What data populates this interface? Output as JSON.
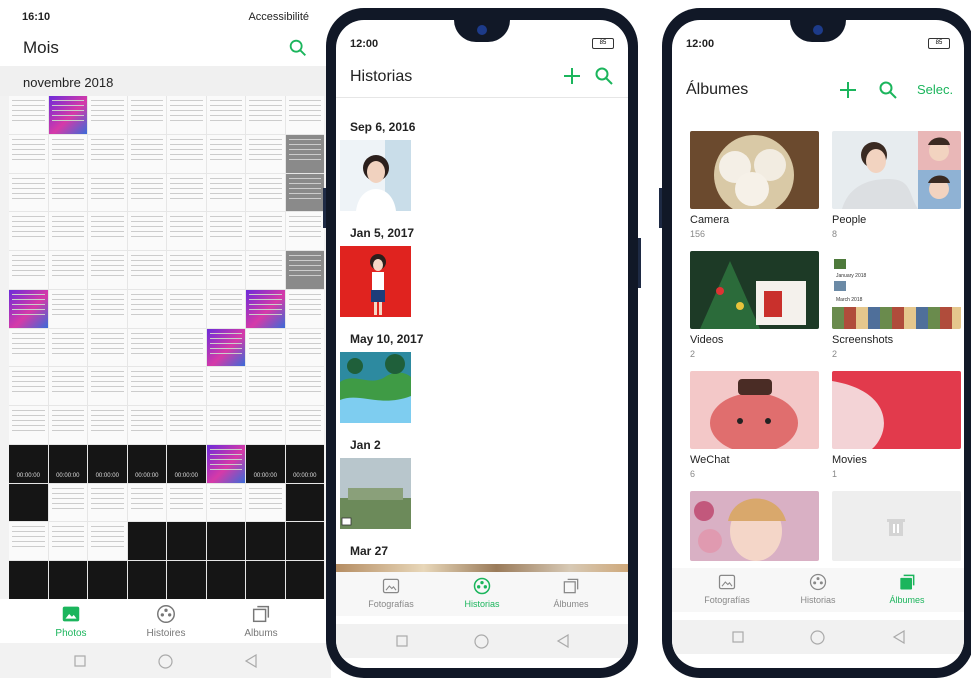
{
  "screen1": {
    "status": {
      "time": "16:10",
      "right_text": "Accessibilité"
    },
    "title": "Mois",
    "month": "novembre 2018",
    "clock_text": "00:00:00",
    "tabs": [
      {
        "label": "Photos",
        "icon": "photos-icon",
        "active": true
      },
      {
        "label": "Histoires",
        "icon": "stories-icon",
        "active": false
      },
      {
        "label": "Albums",
        "icon": "albums-icon",
        "active": false
      }
    ]
  },
  "screen2": {
    "status": {
      "time": "12:00",
      "battery": "85"
    },
    "title": "Historias",
    "dates": [
      "Sep 6, 2016",
      "Jan 5, 2017",
      "May 10, 2017",
      "Jan 2",
      "Mar 27"
    ],
    "tabs": [
      {
        "label": "Fotografías",
        "icon": "photos-icon",
        "active": false
      },
      {
        "label": "Historias",
        "icon": "stories-icon",
        "active": true
      },
      {
        "label": "Álbumes",
        "icon": "albums-icon",
        "active": false
      }
    ]
  },
  "screen3": {
    "status": {
      "time": "12:00",
      "battery": "85"
    },
    "title": "Álbumes",
    "select_label": "Selec.",
    "albums": [
      {
        "name": "Camera",
        "count": "156"
      },
      {
        "name": "People",
        "count": "8"
      },
      {
        "name": "Videos",
        "count": "2"
      },
      {
        "name": "Screenshots",
        "count": "2"
      },
      {
        "name": "WeChat",
        "count": "6"
      },
      {
        "name": "Movies",
        "count": "1"
      }
    ],
    "screenshot_labels": [
      "January 2018",
      "March 2018"
    ],
    "tabs": [
      {
        "label": "Fotografías",
        "icon": "photos-icon",
        "active": false
      },
      {
        "label": "Historias",
        "icon": "stories-icon",
        "active": false
      },
      {
        "label": "Álbumes",
        "icon": "albums-icon",
        "active": true
      }
    ]
  },
  "colors": {
    "accent": "#1bb55c",
    "phone_frame": "#111827"
  }
}
